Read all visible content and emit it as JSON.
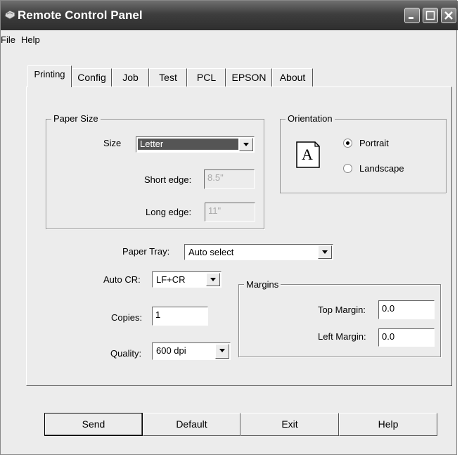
{
  "window": {
    "title": "Remote Control Panel"
  },
  "menu": {
    "items": [
      "File",
      "Help"
    ]
  },
  "tabs": [
    "Printing",
    "Config",
    "Job",
    "Test",
    "PCL",
    "EPSON",
    "About"
  ],
  "active_tab": "Printing",
  "paper_size": {
    "legend": "Paper Size",
    "size_label": "Size",
    "size_value": "Letter",
    "short_edge_label": "Short edge:",
    "short_edge_value": "8.5\"",
    "long_edge_label": "Long edge:",
    "long_edge_value": "11\""
  },
  "orientation": {
    "legend": "Orientation",
    "icon_letter": "A",
    "portrait_label": "Portrait",
    "landscape_label": "Landscape",
    "selected": "Portrait"
  },
  "paper_tray": {
    "label": "Paper Tray:",
    "value": "Auto select"
  },
  "auto_cr": {
    "label": "Auto CR:",
    "value": "LF+CR"
  },
  "copies": {
    "label": "Copies:",
    "value": "1"
  },
  "quality": {
    "label": "Quality:",
    "value": "600 dpi"
  },
  "margins": {
    "legend": "Margins",
    "top_label": "Top Margin:",
    "top_value": "0.0",
    "left_label": "Left Margin:",
    "left_value": "0.0"
  },
  "buttons": {
    "send": "Send",
    "default": "Default",
    "exit": "Exit",
    "help": "Help"
  },
  "colors": {
    "titlebar": "#3e3e3e",
    "face": "#ececec",
    "selection": "#555555"
  }
}
